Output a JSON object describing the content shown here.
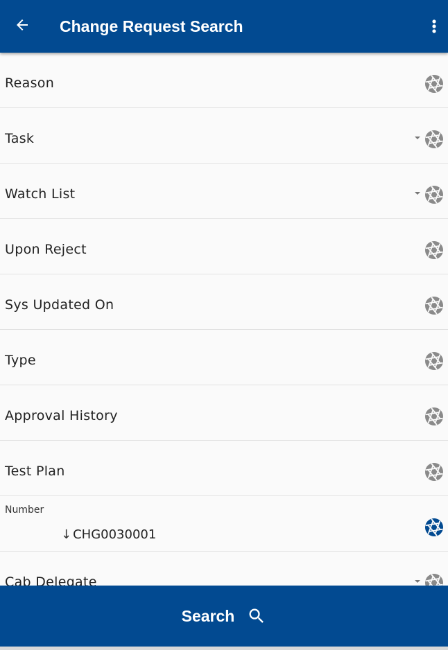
{
  "header": {
    "title": "Change Request Search",
    "back_icon": "arrow-left-icon",
    "menu_icon": "more-vert-icon"
  },
  "fields": [
    {
      "label": "Reason",
      "dropdown": false,
      "active": false
    },
    {
      "label": "Task",
      "dropdown": true,
      "active": false
    },
    {
      "label": "Watch List",
      "dropdown": true,
      "active": false
    },
    {
      "label": "Upon Reject",
      "dropdown": false,
      "active": false
    },
    {
      "label": "Sys Updated On",
      "dropdown": false,
      "active": false
    },
    {
      "label": "Type",
      "dropdown": false,
      "active": false
    },
    {
      "label": "Approval History",
      "dropdown": false,
      "active": false
    },
    {
      "label": "Test Plan",
      "dropdown": false,
      "active": false
    },
    {
      "label": "Number",
      "value": "CHG0030001",
      "sort": "descending",
      "dropdown": false,
      "active": true
    },
    {
      "label": "Cab Delegate",
      "dropdown": true,
      "active": false
    }
  ],
  "search_button": {
    "label": "Search",
    "icon": "search-icon"
  },
  "colors": {
    "primary": "#024a91",
    "icon_inactive": "#8a8a8a",
    "icon_active": "#024a91",
    "background": "#fafafa",
    "divider": "#e2e2e2"
  }
}
